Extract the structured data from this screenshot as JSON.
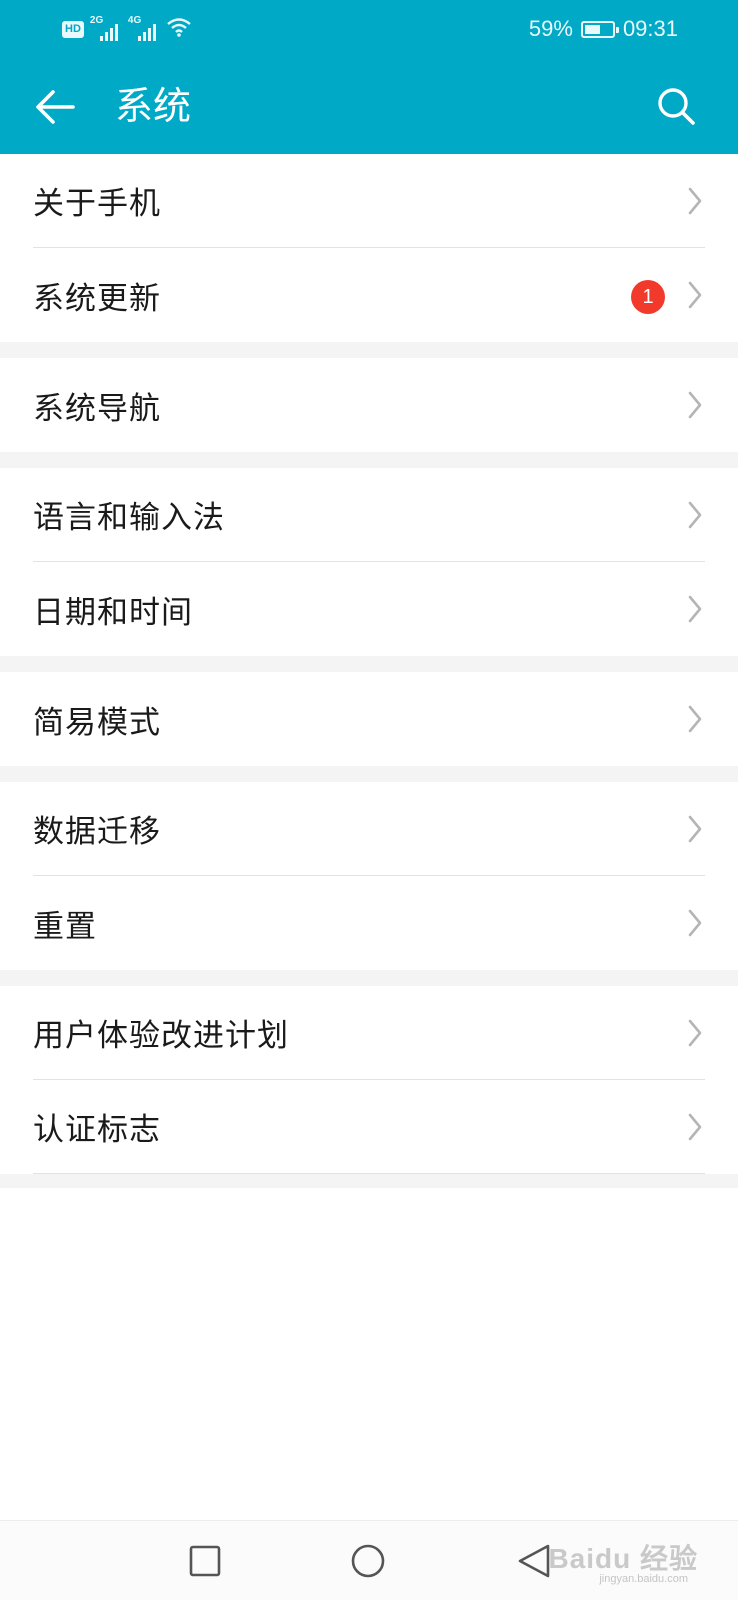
{
  "status_bar": {
    "hd": "HD",
    "network_1": "2G",
    "network_2": "4G",
    "battery_percent": "59%",
    "battery_level": 0.59,
    "time": "09:31"
  },
  "app_bar": {
    "title": "系统",
    "back_icon": "arrow-left-icon",
    "search_icon": "search-icon"
  },
  "colors": {
    "accent": "#00a9c5",
    "badge": "#f13a2c"
  },
  "settings": {
    "groups": [
      {
        "items": [
          {
            "label": "关于手机"
          },
          {
            "label": "系统更新",
            "badge": "1"
          }
        ]
      },
      {
        "items": [
          {
            "label": "系统导航"
          }
        ]
      },
      {
        "items": [
          {
            "label": "语言和输入法"
          },
          {
            "label": "日期和时间"
          }
        ]
      },
      {
        "items": [
          {
            "label": "简易模式"
          }
        ]
      },
      {
        "items": [
          {
            "label": "数据迁移"
          },
          {
            "label": "重置"
          }
        ]
      },
      {
        "items": [
          {
            "label": "用户体验改进计划"
          },
          {
            "label": "认证标志"
          }
        ]
      }
    ]
  },
  "nav_bar": {
    "recent_icon": "square-icon",
    "home_icon": "circle-icon",
    "back_icon": "triangle-back-icon"
  },
  "watermark": {
    "text": "Baidu 经验",
    "sub": "jingyan.baidu.com"
  }
}
